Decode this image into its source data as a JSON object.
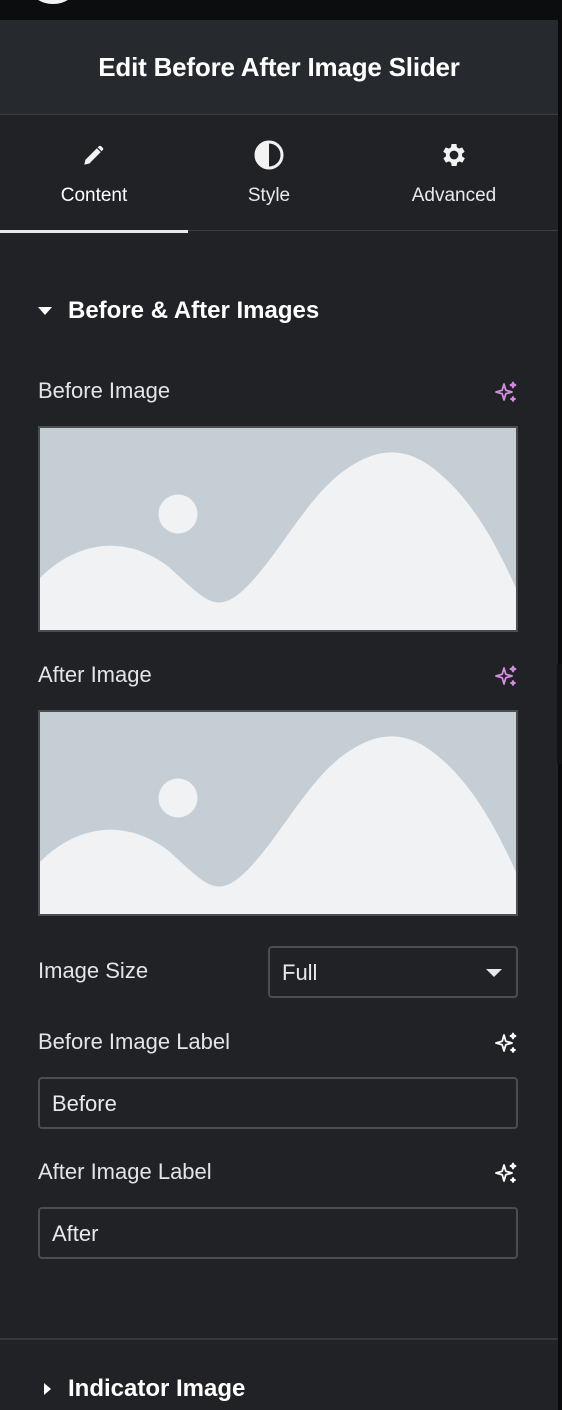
{
  "panel": {
    "title": "Edit Before After Image Slider"
  },
  "tabs": [
    {
      "label": "Content",
      "icon": "pencil-icon",
      "active": true
    },
    {
      "label": "Style",
      "icon": "contrast-icon",
      "active": false
    },
    {
      "label": "Advanced",
      "icon": "gear-icon",
      "active": false
    }
  ],
  "section_before_after": {
    "title": "Before & After Images",
    "expanded": true,
    "before_image_label": "Before Image",
    "after_image_label": "After Image",
    "image_size": {
      "label": "Image Size",
      "value": "Full"
    },
    "before_label_field": {
      "label": "Before Image Label",
      "value": "Before"
    },
    "after_label_field": {
      "label": "After Image Label",
      "value": "After"
    }
  },
  "section_indicator": {
    "title": "Indicator Image",
    "expanded": false
  },
  "colors": {
    "ai_icon_purple": "#d38ce0",
    "ai_icon_white": "#ffffff",
    "placeholder_bg": "#c5ced5",
    "placeholder_fg": "#f1f2f4"
  }
}
